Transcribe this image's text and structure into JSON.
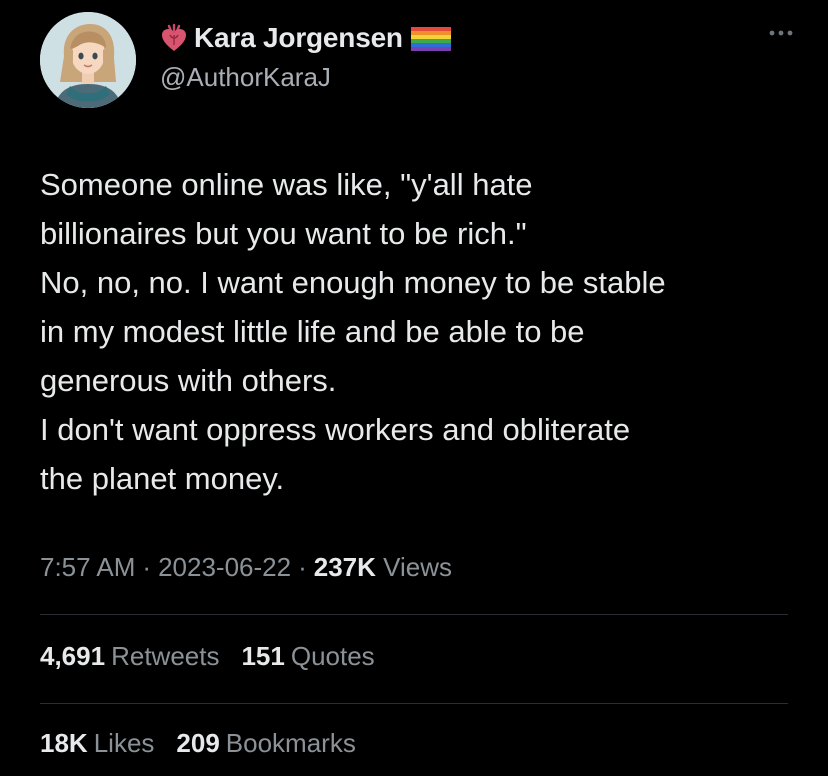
{
  "author": {
    "display_name": "Kara Jorgensen",
    "handle": "@AuthorKaraJ",
    "avatar_icon": "illustrated-portrait-avatar",
    "name_prefix_icon": "anatomical-heart-icon",
    "name_suffix_icon": "rainbow-flag-icon"
  },
  "tweet": {
    "lines": [
      "Someone online was like, \"y'all hate",
      "billionaires but you want to be rich.\"",
      "No, no, no. I want enough money to be stable",
      "in my modest little life and be able to be",
      "generous with others.",
      "I don't want oppress workers and obliterate",
      "the planet money."
    ]
  },
  "meta": {
    "time": "7:57 AM",
    "separator": "·",
    "date": "2023-06-22",
    "views_count": "237K",
    "views_label": "Views"
  },
  "engagement": {
    "retweets_count": "4,691",
    "retweets_label": "Retweets",
    "quotes_count": "151",
    "quotes_label": "Quotes",
    "likes_count": "18K",
    "likes_label": "Likes",
    "bookmarks_count": "209",
    "bookmarks_label": "Bookmarks"
  },
  "colors": {
    "background": "#000000",
    "primary_text": "#e7e9ea",
    "secondary_text": "#8b9297",
    "divider": "#2a2e32"
  }
}
